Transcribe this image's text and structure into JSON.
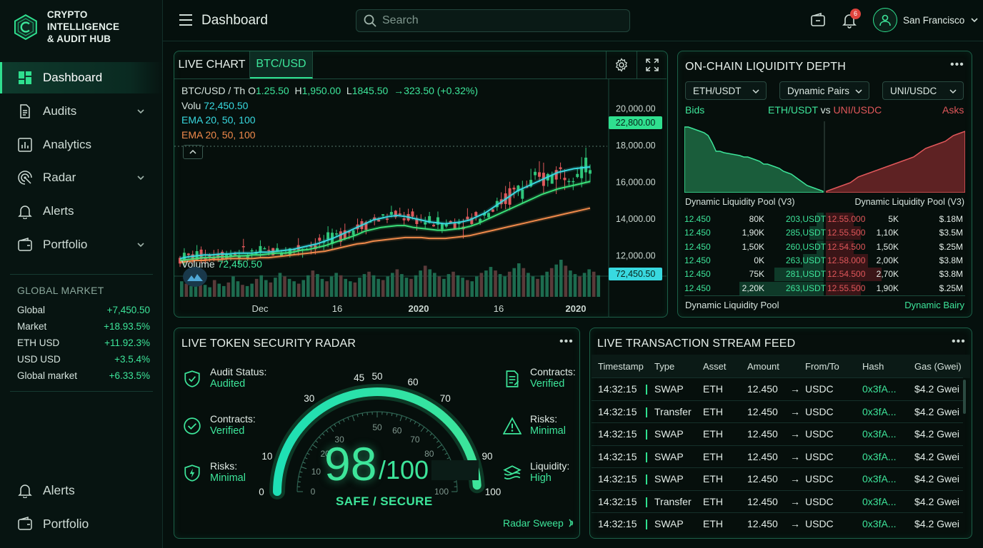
{
  "brand": {
    "line1": "CRYPTO INTELLIGENCE",
    "line2": "& AUDIT HUB"
  },
  "nav": [
    {
      "label": "Dashboard",
      "icon": "dashboard-icon",
      "active": true
    },
    {
      "label": "Audits",
      "icon": "document-icon",
      "chevron": true
    },
    {
      "label": "Analytics",
      "icon": "analytics-icon"
    },
    {
      "label": "Radar",
      "icon": "radar-icon",
      "chevron": true
    },
    {
      "label": "Alerts",
      "icon": "bell-icon"
    },
    {
      "label": "Portfolio",
      "icon": "wallet-icon",
      "chevron": true
    }
  ],
  "nav_bottom": [
    {
      "label": "Alerts",
      "icon": "bell-icon"
    },
    {
      "label": "Portfolio",
      "icon": "wallet-icon"
    }
  ],
  "global_market": {
    "title": "GLOBAL MARKET",
    "rows": [
      {
        "name": "Global",
        "value": "+7,450.50"
      },
      {
        "name": "Market",
        "value": "+18.93.5%"
      },
      {
        "name": "ETH USD",
        "value": "+11.92.3%"
      },
      {
        "name": "USD USD",
        "value": "+3.5.4%"
      },
      {
        "name": "Global market",
        "value": "+6.33.5%"
      }
    ]
  },
  "topbar": {
    "title": "Dashboard",
    "search_placeholder": "Search",
    "notifications": "6",
    "user": "San Francisco"
  },
  "live_chart": {
    "tab": "LIVE CHART",
    "pair": "BTC/USD",
    "ohlc": {
      "prefix": "BTC/USD / Th",
      "open_label": "O",
      "open": "1.25.50",
      "high_label": "H",
      "high": "1,950.00",
      "low_label": "L",
      "low": "1845.50",
      "change": "→323.50 (+0.32%)"
    },
    "vol_label": "Volu",
    "vol_value": "72,450.50",
    "ema1": "EMA 20, 50, 100",
    "ema2": "EMA 20, 50, 100",
    "price_tag": "22,800.00",
    "vol_tag": "72,450.50",
    "volume_label": "Volume",
    "volume_value": "72,450.50",
    "y_ticks": [
      "20,000.00",
      "18,000.00",
      "16,000.00",
      "14,000.00",
      "12,000.00"
    ],
    "x_ticks": [
      "Dec",
      "16",
      "2020",
      "16",
      "2020"
    ],
    "colors": {
      "ema_fast": "#38d9e0",
      "ema_mid": "#3be27a",
      "ema_slow": "#f08a4b",
      "up": "#2fc67a",
      "down": "#e0575a"
    }
  },
  "chart_data": {
    "type": "line",
    "title": "BTC/USD",
    "x": [
      0,
      1,
      2,
      3,
      4,
      5,
      6,
      7,
      8,
      9,
      10,
      11,
      12,
      13,
      14,
      15,
      16,
      17,
      18,
      19,
      20,
      21,
      22,
      23,
      24,
      25,
      26,
      27,
      28,
      29,
      30,
      31,
      32,
      33,
      34,
      35,
      36,
      37,
      38,
      39,
      40,
      41,
      42,
      43,
      44,
      45,
      46,
      47,
      48,
      49,
      50,
      51,
      52,
      53,
      54,
      55,
      56,
      57,
      58,
      59,
      60,
      61,
      62,
      63,
      64,
      65,
      66,
      67,
      68,
      69,
      70,
      71,
      72,
      73,
      74,
      75,
      76,
      77,
      78,
      79,
      80,
      81,
      82,
      83,
      84,
      85,
      86,
      87,
      88,
      89,
      90,
      91,
      92,
      93,
      94,
      95,
      96,
      97,
      98,
      99,
      100,
      101,
      102,
      103,
      104,
      105,
      106,
      107,
      108,
      109,
      110,
      111,
      112,
      113,
      114,
      115,
      116,
      117,
      118,
      119,
      120,
      121,
      122,
      123,
      124,
      125,
      126,
      127,
      128,
      129,
      130,
      131,
      132,
      133,
      134,
      135,
      136,
      137,
      138,
      139,
      140,
      141,
      142,
      143,
      144,
      145
    ],
    "series": [
      {
        "name": "EMA 20, 50, 100",
        "values": [
          11800,
          11900,
          11950,
          12000,
          12000,
          12050,
          12050,
          12100,
          12100,
          12100,
          12150,
          12150,
          12200,
          12250,
          12300,
          12400,
          12500,
          12600,
          12750,
          12900,
          13100,
          13300,
          13500,
          13700,
          13900,
          14000,
          14100,
          14150,
          14100,
          14000,
          13900,
          13800,
          13750,
          13700,
          13750,
          13800,
          13900,
          14100,
          14300,
          14600,
          14900,
          15200,
          15500,
          15700,
          15900,
          16100,
          16300,
          16500,
          16600,
          16700,
          16750,
          16800
        ],
        "x_step": 0.36
      },
      {
        "name": "EMA 20, 50, 100",
        "values": [
          11700,
          11750,
          11800,
          11850,
          11850,
          11900,
          11900,
          11950,
          11950,
          12000,
          12000,
          12050,
          12100,
          12100,
          12150,
          12250,
          12300,
          12400,
          12500,
          12650,
          12800,
          12950,
          13100,
          13300,
          13400,
          13500,
          13550,
          13600,
          13600,
          13500,
          13450,
          13400,
          13350,
          13350,
          13400,
          13450,
          13550,
          13700,
          13900,
          14100,
          14300,
          14500,
          14700,
          14900,
          15100,
          15300,
          15450,
          15600,
          15700,
          15800,
          15900,
          16000
        ]
      },
      {
        "name": "EMA 20, 50, 100",
        "values": [
          11600,
          11650,
          11700,
          11700,
          11750,
          11750,
          11800,
          11800,
          11800,
          11800,
          11850,
          11850,
          11900,
          11950,
          12000,
          12050,
          12100,
          12150,
          12200,
          12300,
          12400,
          12500,
          12600,
          12650,
          12750,
          12800,
          12850,
          12900,
          12950,
          12950,
          12950,
          12900,
          12900,
          12900,
          12950,
          13000,
          13050,
          13150,
          13250,
          13350,
          13450,
          13550,
          13650,
          13750,
          13850,
          13950,
          14050,
          14150,
          14250,
          14350,
          14450,
          14550
        ]
      }
    ],
    "ylim": [
      11000,
      21500
    ],
    "volume": [
      26,
      22,
      18,
      24,
      30,
      20,
      16,
      28,
      22,
      18,
      24,
      34,
      26,
      20,
      18,
      22,
      30,
      36,
      28,
      24,
      32,
      40,
      34,
      30,
      26,
      22,
      28,
      36,
      44,
      38,
      30,
      26,
      34,
      40,
      36,
      30,
      26,
      24,
      32,
      38,
      42,
      36,
      30,
      28,
      34,
      40,
      46,
      38,
      32,
      30,
      36,
      44,
      52,
      46,
      40,
      34,
      30,
      38,
      42,
      36,
      32,
      28,
      26,
      34,
      40,
      44,
      50,
      44,
      38,
      34,
      42,
      48,
      56,
      48,
      40,
      34,
      30,
      36,
      42,
      48,
      54,
      62,
      52,
      44,
      38,
      34,
      40,
      46,
      42,
      36
    ]
  },
  "liquidity": {
    "title": "ON-CHAIN LIQUIDITY DEPTH",
    "selects": [
      "ETH/USDT",
      "Dynamic Pairs",
      "UNI/USDC"
    ],
    "bids": "Bids",
    "asks": "Asks",
    "pair_left": "ETH/USDT",
    "vs": "vs",
    "pair_right": "UNI/USDC",
    "pool_left": "Dynamic Liquidity Pool (V3)",
    "pool_right": "Dynamic Liquidity Pool (V3)",
    "rows": [
      [
        "12.450",
        "80K",
        "203,USDT",
        "12.55.000",
        "5K",
        "$.18M"
      ],
      [
        "12.450",
        "1,90K",
        "285,USDT",
        "12.55.500",
        "1,10K",
        "$3.5M"
      ],
      [
        "12.450",
        "1,50K",
        "260,USDT",
        "12.54.500",
        "1,50K",
        "$.25M"
      ],
      [
        "12.450",
        "0K",
        "263,USDT",
        "12.58.000",
        "2,00K",
        "$3.8M"
      ],
      [
        "12.450",
        "75K",
        "281,USDT",
        "12.54.500",
        "2,70K",
        "$3.8M"
      ],
      [
        "12.450",
        "2,20K",
        "263,USDT",
        "12.55.500",
        "1,90K",
        "$.25M"
      ]
    ],
    "bid_depth": [
      0.05,
      0.1,
      0.05,
      0.15,
      0.35,
      0.6
    ],
    "ask_depth": [
      0.2,
      0.25,
      0.2,
      0.3,
      0.4,
      0.25
    ],
    "footer_left": "Dynamic Liquidity Pool",
    "footer_right": "Dynamic Bairy",
    "bid_curve": [
      92,
      92,
      90,
      88,
      86,
      84,
      80,
      70,
      58,
      58,
      56,
      55,
      54,
      53,
      52,
      50,
      50,
      48,
      46,
      44,
      40,
      40,
      38,
      36,
      34,
      30,
      28,
      26,
      22,
      18,
      14,
      10,
      8,
      6,
      4,
      2
    ],
    "ask_curve": [
      2,
      4,
      6,
      8,
      10,
      12,
      14,
      18,
      22,
      24,
      26,
      28,
      30,
      32,
      34,
      36,
      38,
      40,
      42,
      44,
      46,
      48,
      50,
      54,
      58,
      62,
      64,
      66,
      68,
      70,
      72,
      76,
      80,
      82,
      84,
      86
    ]
  },
  "radar": {
    "title": "LIVE TOKEN SECURITY RADAR",
    "score": "98",
    "max": "/100",
    "status": "SAFE / SECURE",
    "sweep": "Radar Sweep",
    "score_fraction": 0.98,
    "outer_ticks": [
      "0",
      "10",
      "30",
      "45",
      "50",
      "60",
      "70",
      "90",
      "100"
    ],
    "inner_ticks": [
      "0",
      "10",
      "20",
      "30",
      "50",
      "60",
      "70",
      "80",
      "100"
    ],
    "left": [
      {
        "icon": "shield-check-icon",
        "label": "Audit Status:",
        "value": "Audited"
      },
      {
        "icon": "check-circle-icon",
        "label": "Contracts:",
        "value": "Verified"
      },
      {
        "icon": "shield-bolt-icon",
        "label": "Risks:",
        "value": "Minimal"
      }
    ],
    "right": [
      {
        "icon": "contract-icon",
        "label": "Contracts:",
        "value": "Verified"
      },
      {
        "icon": "warning-icon",
        "label": "Risks:",
        "value": "Minimal"
      },
      {
        "icon": "layers-icon",
        "label": "Liquidity:",
        "value": "High"
      }
    ]
  },
  "tx": {
    "title": "LIVE TRANSACTION STREAM FEED",
    "headers": [
      "Timestamp",
      "Type",
      "Asset",
      "Amount",
      "From/To",
      "Hash",
      "Gas (Gwei)"
    ],
    "rows": [
      [
        "14:32:15",
        "SWAP",
        "ETH",
        "12.450",
        "USDC",
        "0x3fA...",
        "$4.2 Gwei"
      ],
      [
        "14:32:15",
        "Transfer",
        "ETH",
        "12.450",
        "USDC",
        "0x3fA...",
        "$4.2 Gwei"
      ],
      [
        "14:32:15",
        "SWAP",
        "ETH",
        "12.450",
        "USDC",
        "0x3fA...",
        "$4.2 Gwei"
      ],
      [
        "14:32:15",
        "SWAP",
        "ETH",
        "12.450",
        "USDC",
        "0x3fA...",
        "$4.2 Gwei"
      ],
      [
        "14:32:15",
        "SWAP",
        "ETH",
        "12.450",
        "USDC",
        "0x3fA...",
        "$4.2 Gwei"
      ],
      [
        "14:32:15",
        "Transfer",
        "ETH",
        "12.450",
        "USDC",
        "0x3fA...",
        "$4.2 Gwei"
      ],
      [
        "14:32:15",
        "SWAP",
        "ETH",
        "12.450",
        "USDC",
        "0x3fA...",
        "$4.2 Gwei"
      ]
    ]
  }
}
